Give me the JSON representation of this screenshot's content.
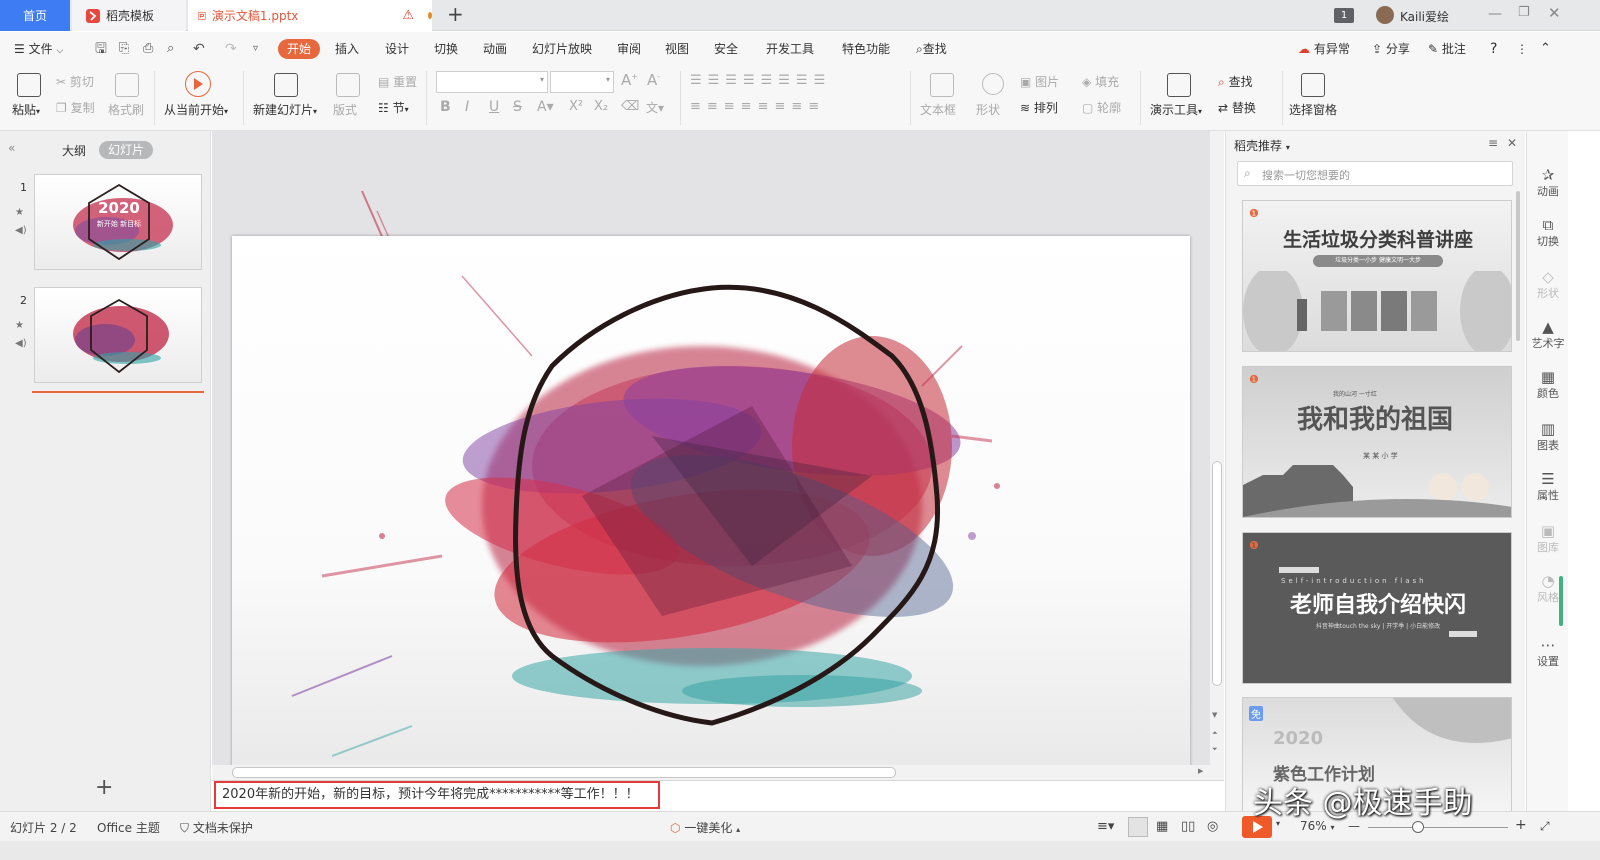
{
  "window": {
    "tabs": [
      {
        "label": "首页"
      },
      {
        "label": "稻壳模板"
      },
      {
        "label": "演示文稿1.pptx"
      }
    ],
    "new_tab_symbol": "+",
    "counter_badge": "1",
    "user_name": "Kaili爱绘"
  },
  "menu": {
    "file_label": "文件",
    "tabs": [
      "开始",
      "插入",
      "设计",
      "切换",
      "动画",
      "幻灯片放映",
      "审阅",
      "视图",
      "安全",
      "开发工具",
      "特色功能"
    ],
    "search_label": "查找",
    "right": {
      "sync": "有异常",
      "share": "分享",
      "comment": "批注",
      "help": "?"
    }
  },
  "ribbon": {
    "paste": "粘贴",
    "cut": "剪切",
    "copy": "复制",
    "format_painter": "格式刷",
    "from_current": "从当前开始",
    "new_slide": "新建幻灯片",
    "layout": "版式",
    "reset": "重置",
    "section": "节",
    "text_box": "文本框",
    "shape": "形状",
    "picture": "图片",
    "fill": "填充",
    "arrange": "排列",
    "outline": "轮廓",
    "present_tools": "演示工具",
    "find": "查找",
    "replace": "替换",
    "selection_pane": "选择窗格"
  },
  "left_panel": {
    "view_outline": "大纲",
    "view_slides": "幻灯片",
    "slides": [
      {
        "number": "1",
        "title": "2020",
        "subtitle": "新开始  新目标"
      },
      {
        "number": "2"
      }
    ],
    "add_symbol": "+"
  },
  "notes": {
    "text": "2020年新的开始，新的目标，预计今年将完成***********等工作！！！"
  },
  "right_panel": {
    "title": "稻壳推荐",
    "search_placeholder": "搜索一切您想要的",
    "cards": [
      {
        "title": "生活垃圾分类科普讲座",
        "subtitle": "垃圾分类一小步  健康文明一大步"
      },
      {
        "title": "我和我的祖国",
        "top": "我的山河 一寸红",
        "sub": "某 某 小 学"
      },
      {
        "title": "老师自我介绍快闪",
        "top": "Self-introduction flash",
        "sub": "抖音神曲touch the sky | 开学季 | 小白能修改"
      },
      {
        "title": "紫色工作计划",
        "year": "2020"
      }
    ]
  },
  "sidebar": {
    "items": [
      "动画",
      "切换",
      "形状",
      "艺术字",
      "颜色",
      "图表",
      "属性",
      "图库",
      "风格",
      "设置"
    ]
  },
  "status": {
    "slide_count": "幻灯片 2 / 2",
    "theme": "Office 主题",
    "protection": "文档未保护",
    "beautify": "一键美化",
    "zoom": "76%"
  },
  "watermark": "头条 @极速手助",
  "colors": {
    "accent": "#e8683e",
    "home_tab": "#3d7cf2",
    "notes_border": "#e53b3b"
  }
}
